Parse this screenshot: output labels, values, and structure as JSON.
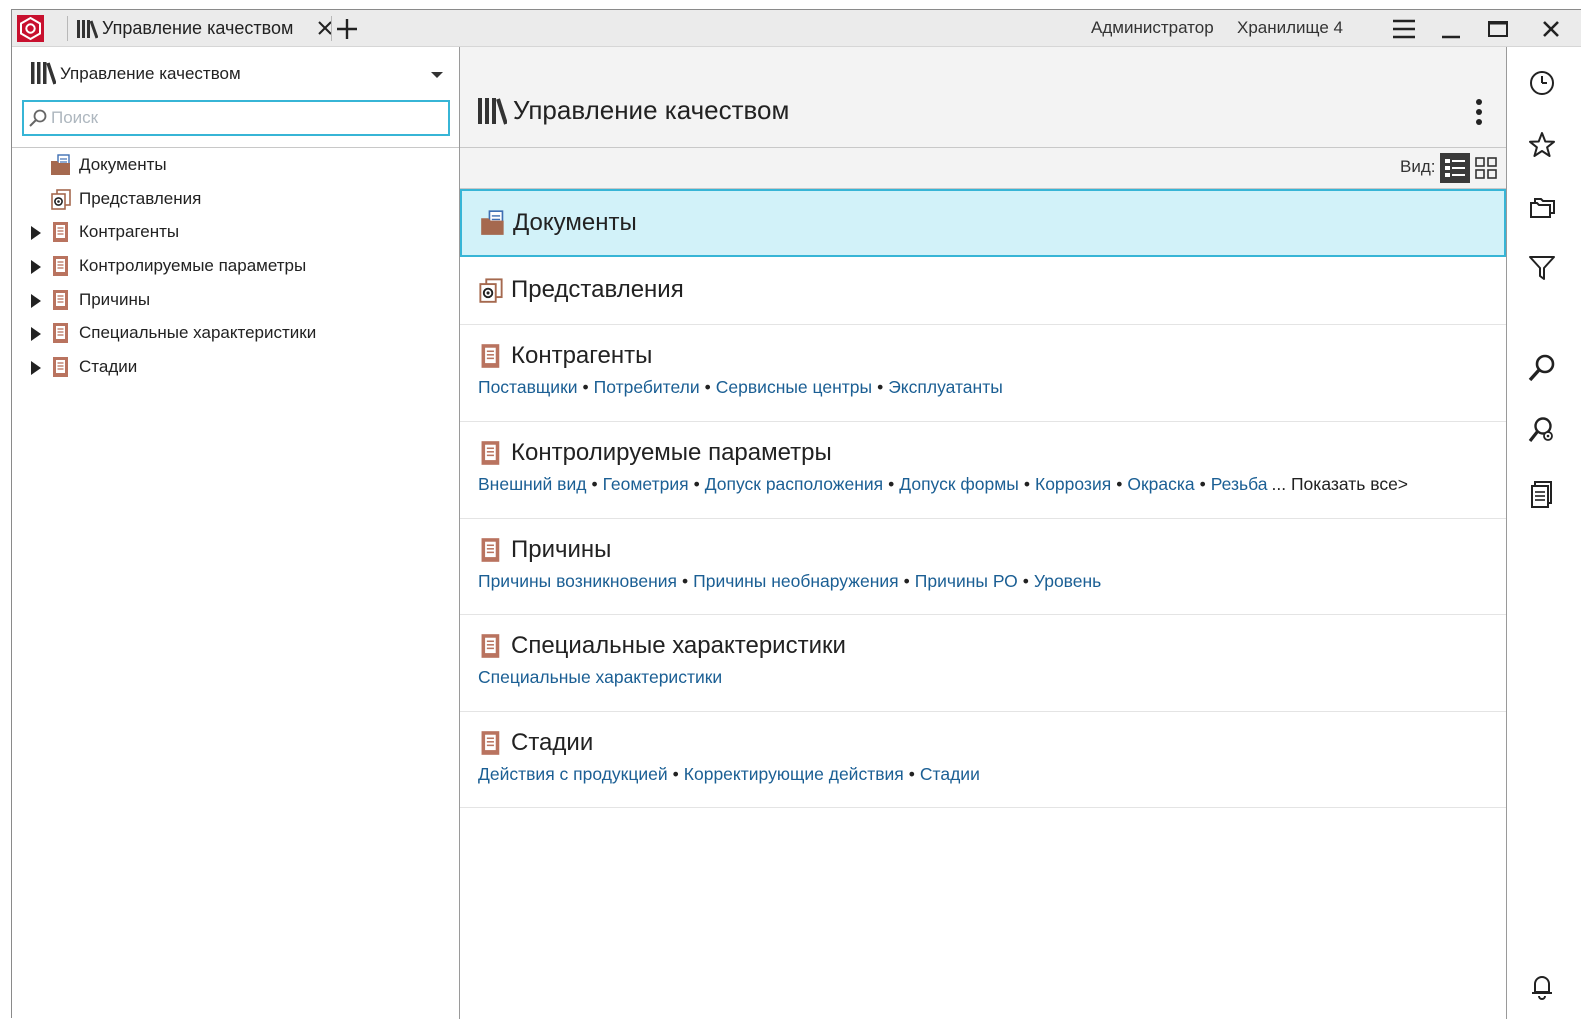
{
  "titlebar": {
    "tab_label": "Управление качеством",
    "user": "Администратор",
    "storage": "Хранилище 4",
    "icons": [
      "app-logo",
      "library-icon",
      "close-icon",
      "plus-icon",
      "hamburger-icon",
      "minimize-icon",
      "maximize-icon",
      "close-window-icon"
    ]
  },
  "sidebar": {
    "title": "Управление качеством",
    "search_placeholder": "Поиск",
    "items": [
      {
        "label": "Документы",
        "expandable": false,
        "icon": "documents-folder-icon"
      },
      {
        "label": "Представления",
        "expandable": false,
        "icon": "views-icon"
      },
      {
        "label": "Контрагенты",
        "expandable": true,
        "icon": "book-icon"
      },
      {
        "label": "Контролируемые параметры",
        "expandable": true,
        "icon": "book-icon"
      },
      {
        "label": "Причины",
        "expandable": true,
        "icon": "book-icon"
      },
      {
        "label": "Специальные характеристики",
        "expandable": true,
        "icon": "book-icon"
      },
      {
        "label": "Стадии",
        "expandable": true,
        "icon": "book-icon"
      }
    ]
  },
  "main": {
    "title": "Управление качеством",
    "view_label": "Вид:",
    "show_all": "... Показать все>",
    "cards": [
      {
        "title": "Документы",
        "icon": "documents-folder-icon",
        "selected": true,
        "links": []
      },
      {
        "title": "Представления",
        "icon": "views-icon",
        "selected": false,
        "links": []
      },
      {
        "title": "Контрагенты",
        "icon": "book-icon",
        "selected": false,
        "links": [
          "Поставщики",
          "Потребители",
          "Сервисные центры",
          "Эксплуатанты"
        ]
      },
      {
        "title": "Контролируемые параметры",
        "icon": "book-icon",
        "selected": false,
        "links": [
          "Внешний вид",
          "Геометрия",
          "Допуск расположения",
          "Допуск формы",
          "Коррозия",
          "Окраска",
          "Резьба"
        ],
        "truncated": true
      },
      {
        "title": "Причины",
        "icon": "book-icon",
        "selected": false,
        "links": [
          "Причины возникновения",
          "Причины необнаружения",
          "Причины РО",
          "Уровень"
        ]
      },
      {
        "title": "Специальные характеристики",
        "icon": "book-icon",
        "selected": false,
        "links": [
          "Специальные характеристики"
        ]
      },
      {
        "title": "Стадии",
        "icon": "book-icon",
        "selected": false,
        "links": [
          "Действия с продукцией",
          "Корректирующие действия",
          "Стадии"
        ]
      }
    ]
  },
  "rail": {
    "icons": [
      "history-icon",
      "star-icon",
      "folders-icon",
      "filter-icon",
      "search-icon",
      "advanced-search-icon",
      "documents-list-icon",
      "bell-icon"
    ]
  },
  "colors": {
    "accent": "#37b5d6",
    "selected_bg": "#d2f2f9",
    "link": "#1b5f94",
    "book_icon": "#b9735f",
    "logo": "#c8102e"
  }
}
